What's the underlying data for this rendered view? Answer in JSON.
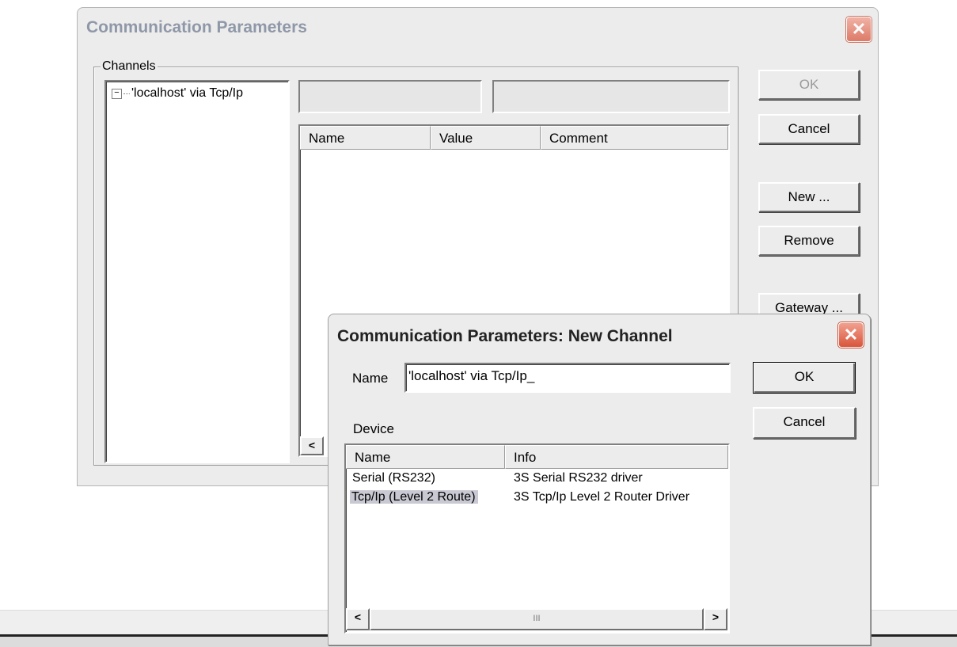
{
  "main_window": {
    "title": "Communication Parameters",
    "close_glyph": "✕",
    "channels_group_label": "Channels",
    "tree": {
      "toggle_glyph": "−",
      "items": [
        {
          "label": "'localhost' via Tcp/Ip",
          "expanded": true
        }
      ]
    },
    "params_table": {
      "columns": [
        "Name",
        "Value",
        "Comment"
      ],
      "rows": []
    },
    "buttons": {
      "ok": "OK",
      "cancel": "Cancel",
      "new": "New ...",
      "remove": "Remove",
      "gateway": "Gateway ..."
    },
    "scroll_left_glyph": "<"
  },
  "new_channel_dialog": {
    "title": "Communication Parameters: New Channel",
    "close_glyph": "✕",
    "name_label": "Name",
    "name_value": "'localhost' via Tcp/Ip_",
    "device_label": "Device",
    "device_table": {
      "columns": [
        "Name",
        "Info"
      ],
      "rows": [
        {
          "name": "Serial (RS232)",
          "info": "3S Serial RS232 driver",
          "selected": false
        },
        {
          "name": "Tcp/Ip (Level 2 Route)",
          "info": "3S Tcp/Ip Level 2 Router Driver",
          "selected": true
        }
      ]
    },
    "scroll_left_glyph": "<",
    "scroll_right_glyph": ">",
    "scroll_thumb_glyph": "III",
    "buttons": {
      "ok": "OK",
      "cancel": "Cancel"
    }
  },
  "colors": {
    "title_close_red": "#d9553c",
    "selection_bg": "#c9c9d3",
    "inactive_title": "#8f98a8"
  }
}
